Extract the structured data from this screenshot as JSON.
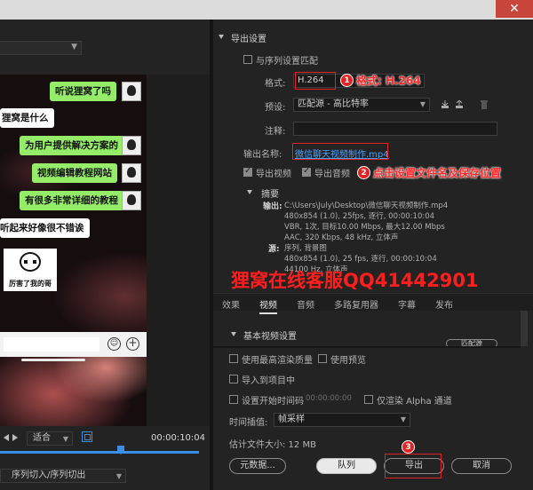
{
  "window": {
    "close_label": "✕"
  },
  "left": {
    "chat": [
      {
        "text": "听说狸窝了吗",
        "side": "right"
      },
      {
        "text": "狸窝是什么",
        "side": "left"
      },
      {
        "text": "为用户提供解决方案的",
        "side": "right"
      },
      {
        "text": "视频编辑教程网站",
        "side": "right"
      },
      {
        "text": "有很多非常详细的教程",
        "side": "right"
      },
      {
        "text": "听起来好像很不错诶",
        "side": "left"
      }
    ],
    "sticker_caption": "厉害了我的哥",
    "emoji_glyph": "☺",
    "plus_glyph": "+",
    "fit_select": "适合",
    "timecode": "00:00:10:04",
    "sequence_select": "序列切入/序列切出"
  },
  "export": {
    "section_title": "导出设置",
    "match_sequence_label": "与序列设置匹配",
    "format_label": "格式:",
    "format_value": "H.264",
    "preset_label": "预设:",
    "preset_value": "匹配源 - 高比特率",
    "comment_label": "注释:",
    "output_name_label": "输出名称:",
    "output_name_value": "微信聊天视频制作.mp4",
    "export_video_label": "导出视频",
    "export_audio_label": "导出音频",
    "summary_title": "摘要",
    "output_key": "输出:",
    "output_lines": [
      "C:\\Users\\July\\Desktop\\微信聊天视频制作.mp4",
      "480x854 (1.0), 25fps, 逐行, 00:00:10:04",
      "VBR, 1次, 目标10.00 Mbps, 最大12.00 Mbps",
      "AAC, 320 Kbps, 48 kHz, 立体声"
    ],
    "source_key": "源:",
    "source_lines": [
      "序列, 背景图",
      "480x854 (1.0), 25 fps, 逐行, 00:00:10:04",
      "44100 Hz, 立体声"
    ]
  },
  "annotations": {
    "badge1": "1",
    "text1": "格式: H.264",
    "badge2": "2",
    "text2": "点击设置文件名及保存位置",
    "badge3": "3",
    "watermark": "狸窝在线客服QQ41442901"
  },
  "tabs": [
    "效果",
    "视频",
    "音频",
    "多路复用器",
    "字幕",
    "发布"
  ],
  "active_tab": "视频",
  "video": {
    "basic_settings": "基本视频设置",
    "match_source_btn": "匹配源"
  },
  "bottom": {
    "max_render_quality": "使用最高渲染质量",
    "use_preview": "使用预览",
    "import_into_project": "导入到项目中",
    "set_start_timecode": "设置开始时间码",
    "start_timecode_value": "00:00:00:00",
    "render_alpha_only": "仅渲染 Alpha 通道",
    "time_interpolation_label": "时间插值:",
    "time_interpolation_value": "帧采样",
    "estimated_size": "估计文件大小: 12 MB",
    "metadata_btn": "元数据...",
    "queue_btn": "队列",
    "export_btn": "导出",
    "cancel_btn": "取消"
  },
  "colors": {
    "annotation_red": "#e02424",
    "link_blue": "#4aa3ff",
    "chat_green": "#95ec69"
  }
}
